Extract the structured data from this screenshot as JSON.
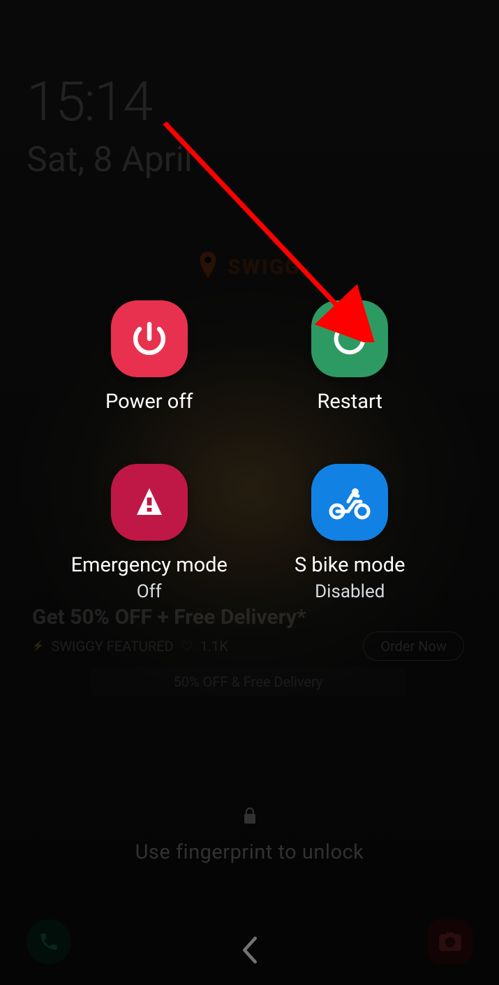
{
  "lockscreen": {
    "time": "15:14",
    "date": "Sat, 8 April",
    "brand_name": "SWIGG",
    "promo_headline": "Get 50% OFF + Free Delivery*",
    "promo_tag": "SWIGGY  FEATURED",
    "promo_likes": "1.1K",
    "order_button": "Order Now",
    "promo_pill": "50% OFF & Free Delivery",
    "unlock_hint": "Use fingerprint to unlock"
  },
  "power_menu": {
    "power_off": {
      "label": "Power off"
    },
    "restart": {
      "label": "Restart"
    },
    "emergency": {
      "label": "Emergency mode",
      "status": "Off"
    },
    "sbike": {
      "label": "S bike mode",
      "status": "Disabled"
    }
  },
  "annotation": {
    "target": "restart-button",
    "color": "#ff0000"
  }
}
